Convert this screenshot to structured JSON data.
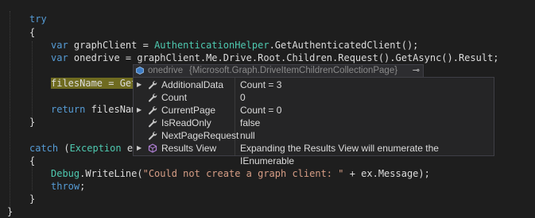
{
  "code": {
    "try_kw": "try",
    "brace_open": "{",
    "brace_close": "}",
    "line_var1_kw": "var",
    "line_var1_rest": " graphClient = ",
    "line_var1_type": "AuthenticationHelper",
    "line_var1_end": ".GetAuthenticatedClient();",
    "line_var2_kw": "var",
    "line_var2_rest": " onedrive = graphClient.Me.Drive.Root.Children.Request().GetAsync().Result;",
    "line_files_hl": "filesName = Get",
    "return_kw": "return",
    "return_rest": " filesNam",
    "catch_kw": "catch",
    "catch_open": " (",
    "catch_type": "Exception",
    "catch_rest": " ex",
    "debug_type": "Debug",
    "debug_mid": ".WriteLine(",
    "debug_str": "\"Could not create a graph client: \"",
    "debug_end": " + ex.Message);",
    "throw_kw": "throw",
    "throw_end": ";"
  },
  "tooltip": {
    "name": "onedrive",
    "type": "{Microsoft.Graph.DriveItemChildrenCollectionPage}",
    "pin_icon": "pin-icon"
  },
  "datatip": {
    "rows": [
      {
        "name": "AdditionalData",
        "value": "Count = 3",
        "expandable": true,
        "icon": "wrench-icon"
      },
      {
        "name": "Count",
        "value": "0",
        "expandable": false,
        "icon": "wrench-icon"
      },
      {
        "name": "CurrentPage",
        "value": "Count = 0",
        "expandable": true,
        "icon": "wrench-icon"
      },
      {
        "name": "IsReadOnly",
        "value": "false",
        "expandable": false,
        "icon": "wrench-icon"
      },
      {
        "name": "NextPageRequest",
        "value": "null",
        "expandable": false,
        "icon": "wrench-icon"
      },
      {
        "name": "Results View",
        "value": "Expanding the Results View will enumerate the IEnumerable",
        "expandable": true,
        "icon": "results-view-icon"
      }
    ]
  },
  "colors": {
    "background": "#1e1e1e",
    "keyword": "#569cd6",
    "type": "#4ec9b0",
    "string": "#d69d85",
    "highlight": "#6f6b20"
  }
}
